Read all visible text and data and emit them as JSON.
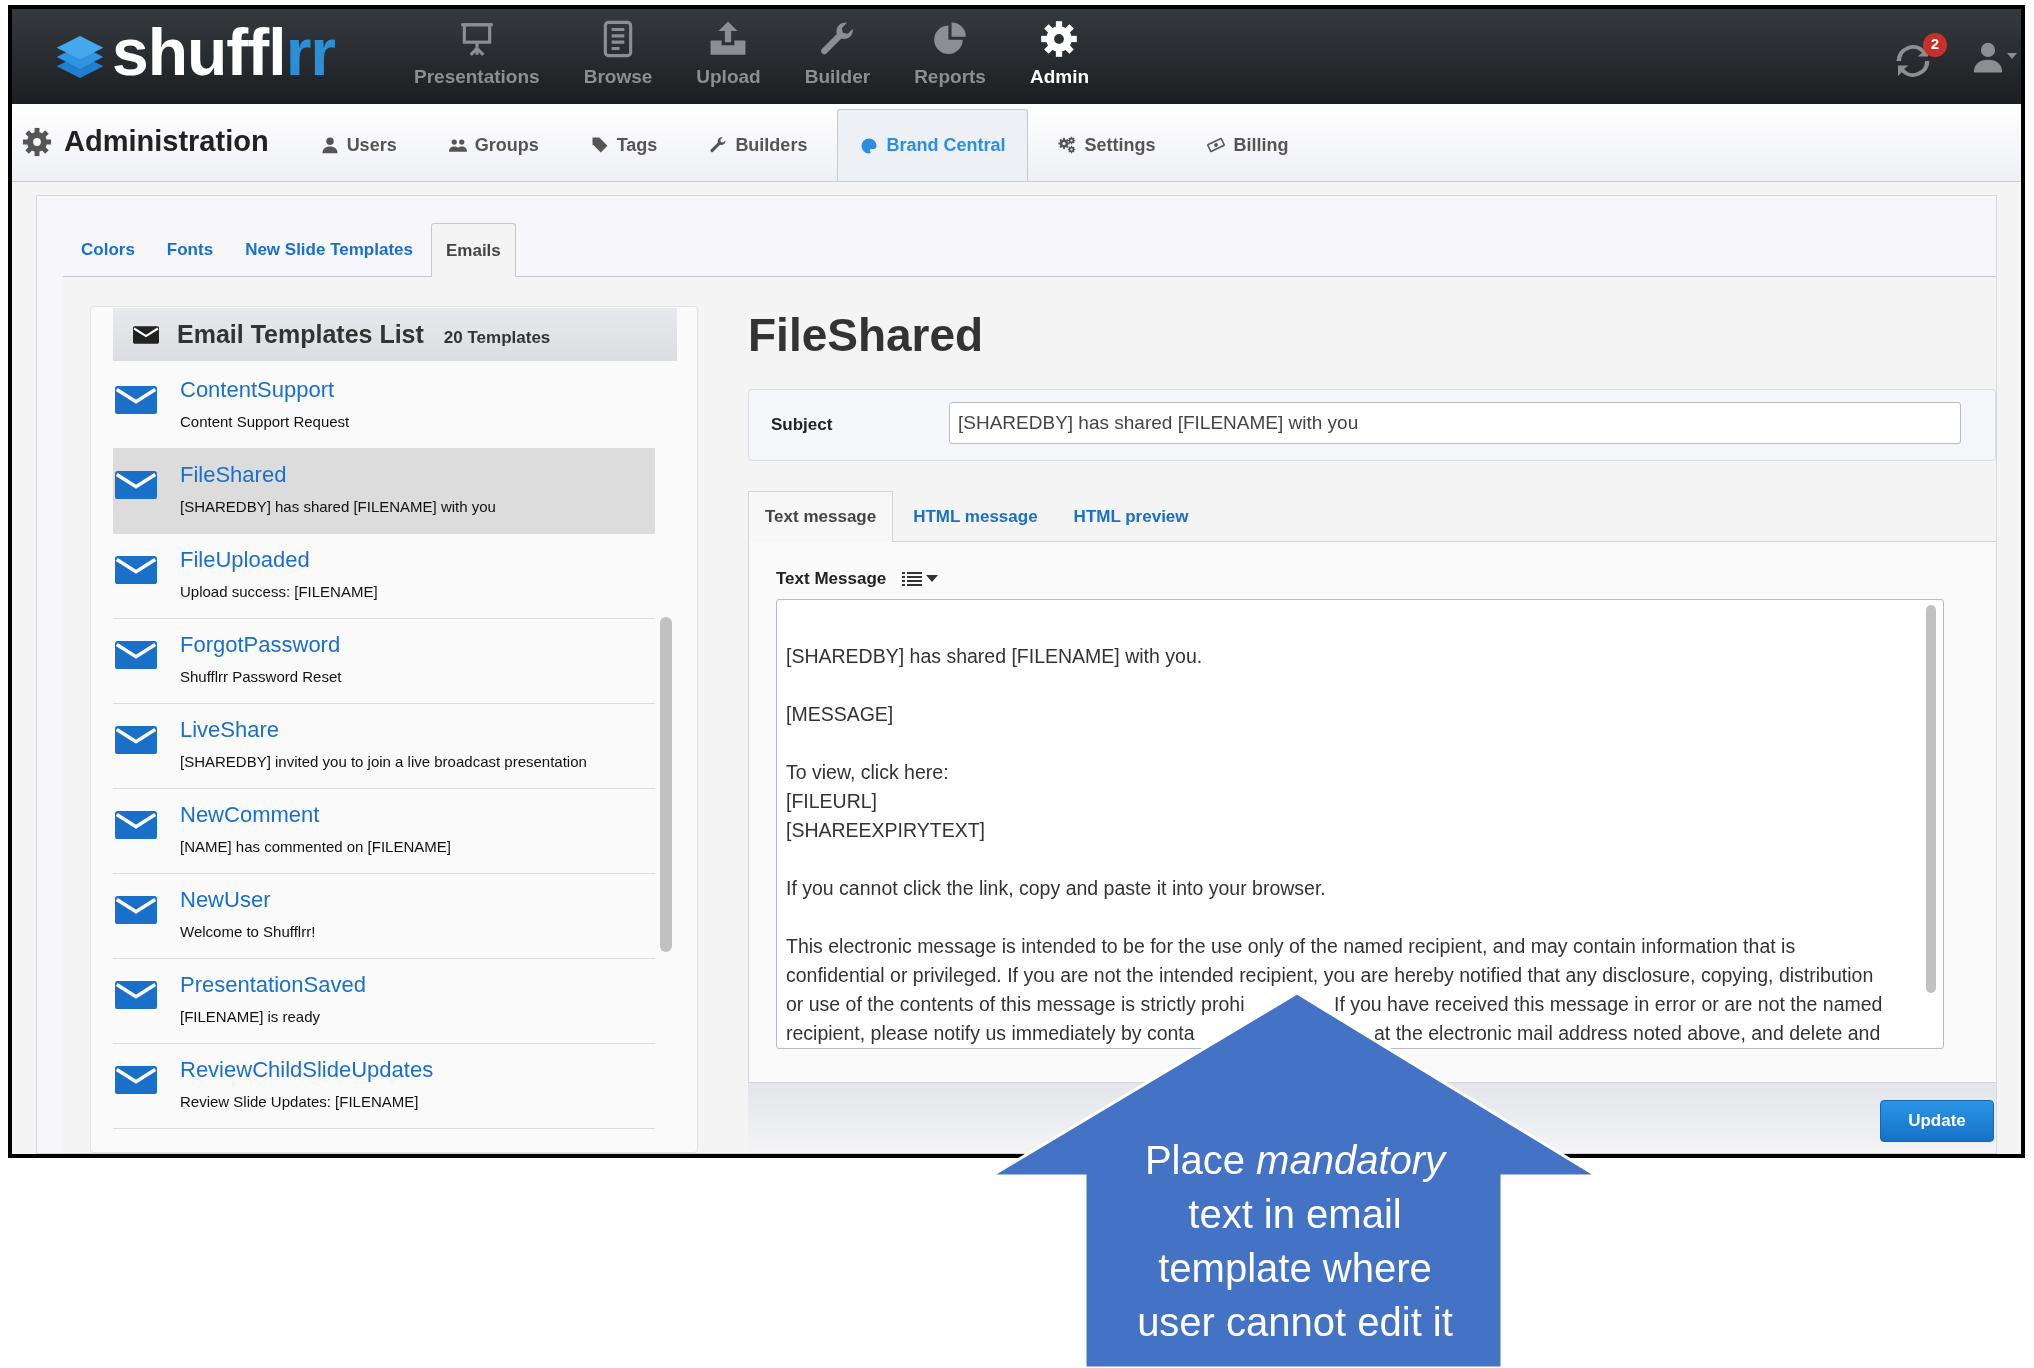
{
  "nav": {
    "logo": [
      {
        "text": "shuffl",
        "accent": false
      },
      {
        "text": "rr",
        "accent": true
      }
    ],
    "items": [
      {
        "label": "Presentations",
        "selected": false
      },
      {
        "label": "Browse",
        "selected": false
      },
      {
        "label": "Upload",
        "selected": false
      },
      {
        "label": "Builder",
        "selected": false
      },
      {
        "label": "Reports",
        "selected": false
      },
      {
        "label": "Admin",
        "selected": true
      }
    ],
    "notification_count": "2"
  },
  "admin": {
    "title": "Administration",
    "tabs": [
      {
        "label": "Users",
        "selected": false
      },
      {
        "label": "Groups",
        "selected": false
      },
      {
        "label": "Tags",
        "selected": false
      },
      {
        "label": "Builders",
        "selected": false
      },
      {
        "label": "Brand Central",
        "selected": true
      },
      {
        "label": "Settings",
        "selected": false
      },
      {
        "label": "Billing",
        "selected": false
      }
    ]
  },
  "subtabs": [
    {
      "label": "Colors",
      "selected": false
    },
    {
      "label": "Fonts",
      "selected": false
    },
    {
      "label": "New Slide Templates",
      "selected": false
    },
    {
      "label": "Emails",
      "selected": true
    }
  ],
  "templates": {
    "title": "Email Templates List",
    "count": "20 Templates",
    "items": [
      {
        "name": "ContentSupport",
        "subject": "Content Support Request",
        "selected": false
      },
      {
        "name": "FileShared",
        "subject": "[SHAREDBY] has shared [FILENAME] with you",
        "selected": true
      },
      {
        "name": "FileUploaded",
        "subject": "Upload success: [FILENAME]",
        "selected": false
      },
      {
        "name": "ForgotPassword",
        "subject": "Shufflrr Password Reset",
        "selected": false
      },
      {
        "name": "LiveShare",
        "subject": "[SHAREDBY] invited you to join a live broadcast presentation",
        "selected": false
      },
      {
        "name": "NewComment",
        "subject": "[NAME] has commented on [FILENAME]",
        "selected": false
      },
      {
        "name": "NewUser",
        "subject": "Welcome to Shufflrr!",
        "selected": false
      },
      {
        "name": "PresentationSaved",
        "subject": "[FILENAME] is ready",
        "selected": false
      },
      {
        "name": "ReviewChildSlideUpdates",
        "subject": "Review Slide Updates: [FILENAME]",
        "selected": false
      }
    ]
  },
  "detail": {
    "title": "FileShared",
    "subject_label": "Subject",
    "subject": "[SHAREDBY] has shared [FILENAME] with you",
    "tabs": [
      {
        "label": "Text message",
        "selected": true
      },
      {
        "label": "HTML message",
        "selected": false
      },
      {
        "label": "HTML preview",
        "selected": false
      }
    ],
    "editor_label": "Text Message",
    "lines": [
      {
        "kind": "text",
        "text": "[SHAREDBY] has shared [FILENAME] with you."
      },
      {
        "kind": "blank"
      },
      {
        "kind": "text",
        "text": "[MESSAGE]"
      },
      {
        "kind": "blank"
      },
      {
        "kind": "text",
        "text": "To view, click here:"
      },
      {
        "kind": "text",
        "text": "[FILEURL]"
      },
      {
        "kind": "text",
        "text": "[SHAREEXPIRYTEXT]"
      },
      {
        "kind": "blank"
      },
      {
        "kind": "text",
        "text": "If you cannot click the link, copy and paste it into your browser."
      },
      {
        "kind": "blank"
      },
      {
        "kind": "text",
        "text": "This electronic message is intended to be for the use only of the named recipient, and may contain information that is"
      },
      {
        "kind": "text",
        "text": "confidential or privileged. If you are not the intended recipient, you are hereby notified that any disclosure, copying, distribution"
      },
      {
        "kind": "split",
        "left": "or use of the contents of this message is strictly prohi",
        "right": "If you have received this message in error or are not the named"
      },
      {
        "kind": "split",
        "left": "recipient, please notify us immediately by conta",
        "right": "at the electronic mail address noted above, and delete and"
      }
    ],
    "button": "Update"
  },
  "callout": {
    "lines": [
      "Place *mandatory*",
      "text in email",
      "template where",
      "user cannot edit it"
    ]
  }
}
